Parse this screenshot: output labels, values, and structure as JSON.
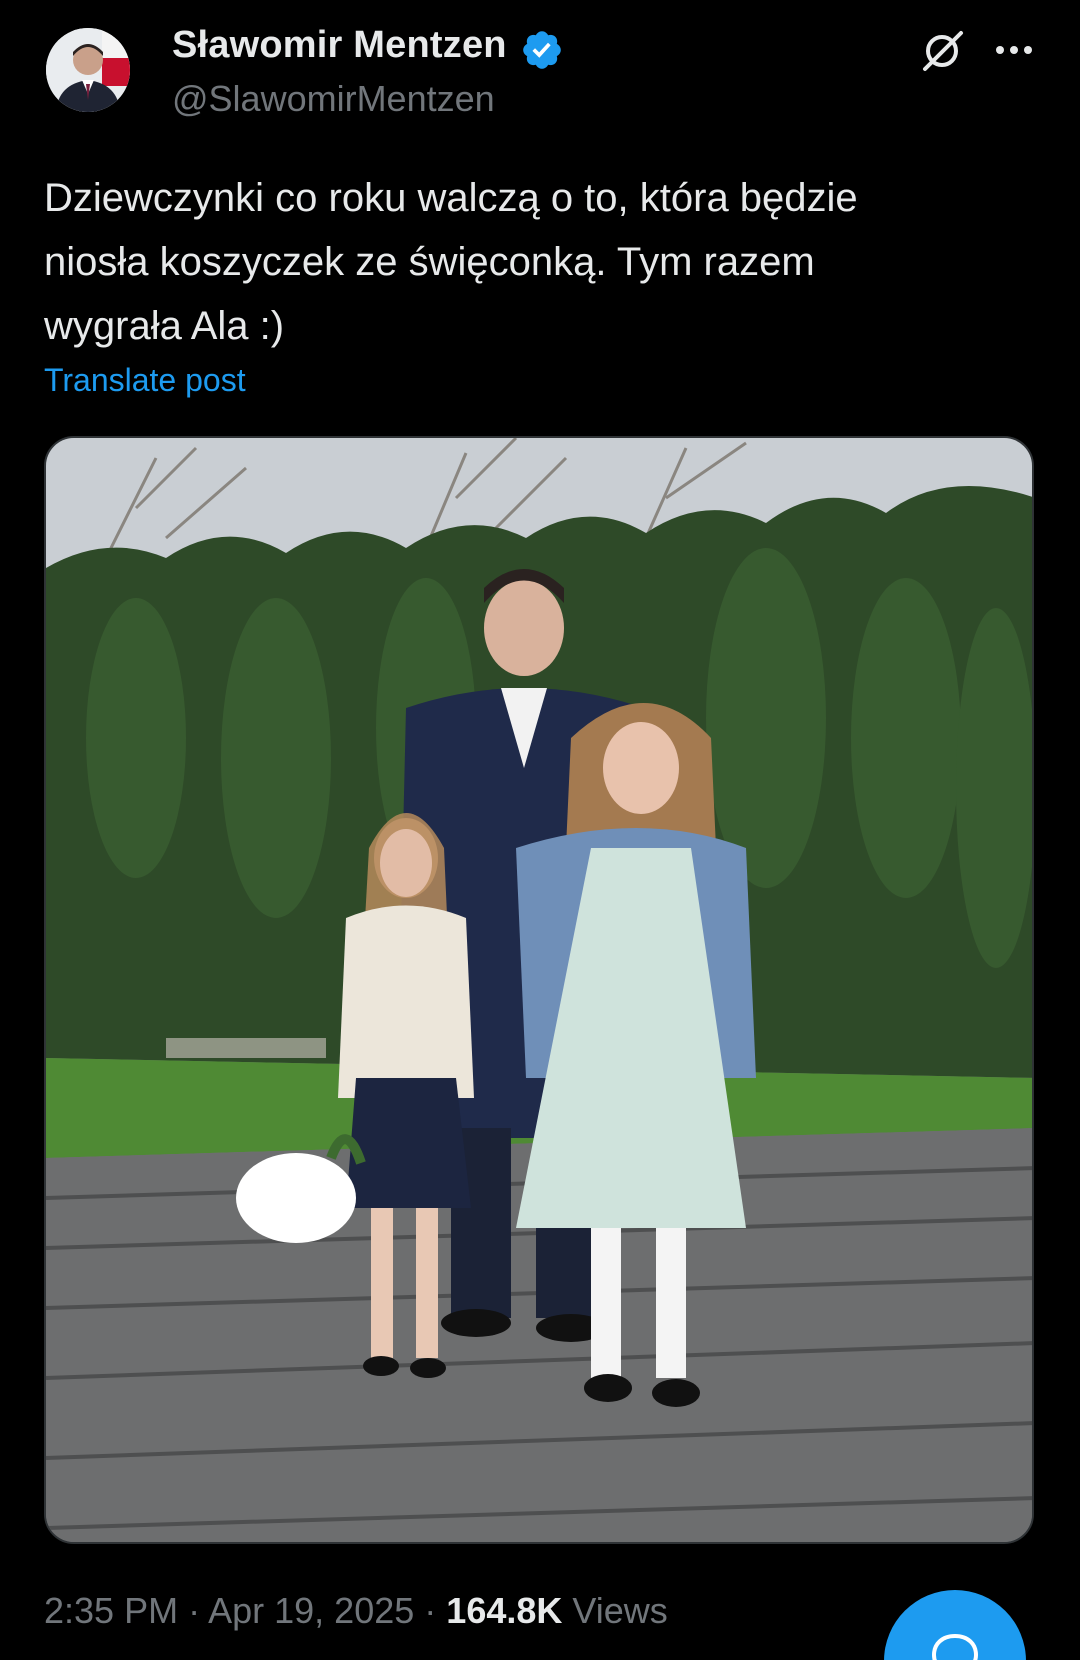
{
  "author": {
    "display_name": "Sławomir Mentzen",
    "handle": "@SlawomirMentzen",
    "verified": true
  },
  "post": {
    "text_lines": [
      "Dziewczynki co roku walczą o to, która będzie",
      "niosła koszyczek ze święconką. Tym razem",
      "wygrała Ala :)"
    ],
    "translate_label": "Translate post"
  },
  "meta": {
    "time": "2:35 PM",
    "separator": "·",
    "date": "Apr 19, 2025",
    "views_count": "164.8K",
    "views_label": "Views"
  },
  "icons": {
    "header_right": [
      "grok-icon",
      "more-options-icon"
    ],
    "verified": "verified-badge-icon",
    "fab": "compose-reply-icon"
  },
  "colors": {
    "background": "#000000",
    "text": "#e7e9ea",
    "muted": "#71767b",
    "accent": "#1d9bf0"
  }
}
